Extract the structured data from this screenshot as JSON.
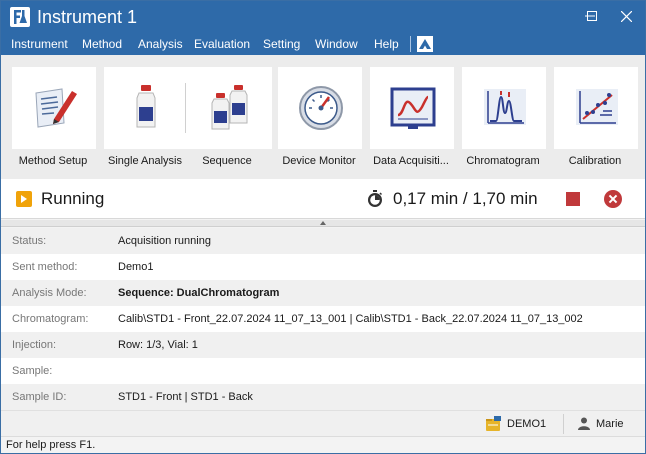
{
  "window": {
    "title": "Instrument 1"
  },
  "menu": {
    "items": [
      "Instrument",
      "Method",
      "Analysis",
      "Evaluation",
      "Setting",
      "Window",
      "Help"
    ]
  },
  "toolbar": {
    "tools": [
      {
        "label": "Method Setup",
        "icon": "method-setup-icon"
      },
      {
        "label": "Single Analysis",
        "icon": "single-analysis-icon"
      },
      {
        "label": "Sequence",
        "icon": "sequence-icon"
      },
      {
        "label": "Device Monitor",
        "icon": "device-monitor-icon"
      },
      {
        "label": "Data Acquisiti...",
        "icon": "data-acquisition-icon"
      },
      {
        "label": "Chromatogram",
        "icon": "chromatogram-icon"
      },
      {
        "label": "Calibration",
        "icon": "calibration-icon"
      }
    ]
  },
  "run": {
    "status": "Running",
    "time": "0,17 min / 1,70 min"
  },
  "info": {
    "rows": [
      {
        "label": "Status:",
        "value": "Acquisition running"
      },
      {
        "label": "Sent method:",
        "value": "Demo1"
      },
      {
        "label": "Analysis Mode:",
        "value": "Sequence: DualChromatogram"
      },
      {
        "label": "Chromatogram:",
        "value": "Calib\\STD1 - Front_22.07.2024 11_07_13_001 | Calib\\STD1 - Back_22.07.2024 11_07_13_002"
      },
      {
        "label": "Injection:",
        "value": "Row: 1/3, Vial: 1"
      },
      {
        "label": "Sample:",
        "value": ""
      },
      {
        "label": "Sample ID:",
        "value": "STD1 - Front | STD1 - Back"
      }
    ]
  },
  "footer": {
    "database": "DEMO1",
    "user": "Marie"
  },
  "statusbar": {
    "text": "For help press F1."
  },
  "colors": {
    "titlebar": "#2e6aa9",
    "running": "#f0a30a",
    "stop": "#c0393b"
  }
}
